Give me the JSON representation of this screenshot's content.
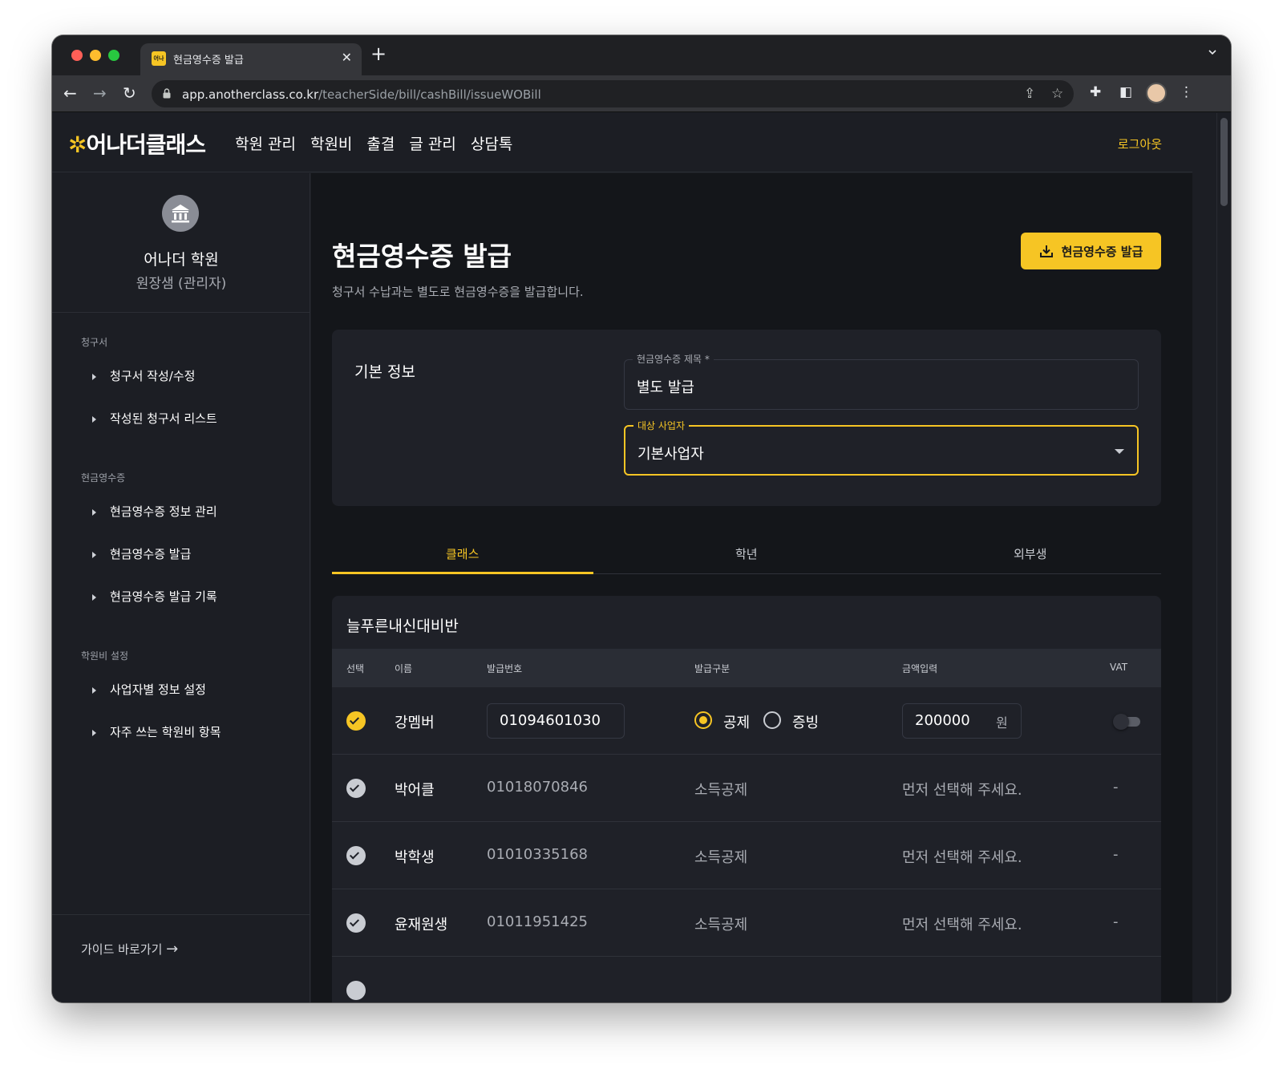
{
  "browser": {
    "tab_title": "현금영수증 발급",
    "favicon_text": "어나",
    "url_host": "app.anotherclass.co.kr",
    "url_path": "/teacherSide/bill/cashBill/issueWOBill"
  },
  "header": {
    "logo": "어나더클래스",
    "nav": [
      "학원 관리",
      "학원비",
      "출결",
      "글 관리",
      "상담톡"
    ],
    "logout": "로그아웃"
  },
  "sidebar": {
    "org_name": "어나더 학원",
    "org_role": "원장샘 (관리자)",
    "sections": [
      {
        "title": "청구서",
        "items": [
          "청구서 작성/수정",
          "작성된 청구서 리스트"
        ]
      },
      {
        "title": "현금영수증",
        "items": [
          "현금영수증 정보 관리",
          "현금영수증 발급",
          "현금영수증 발급 기록"
        ]
      },
      {
        "title": "학원비 설정",
        "items": [
          "사업자별 정보 설정",
          "자주 쓰는 학원비 항목"
        ]
      }
    ],
    "guide_link": "가이드 바로가기"
  },
  "main": {
    "title": "현금영수증 발급",
    "description": "청구서 수납과는 별도로 현금영수증을 발급합니다.",
    "issue_button": "현금영수증 발급",
    "basic_info": {
      "heading": "기본 정보",
      "receipt_title_label": "현금영수증 제목 *",
      "receipt_title_value": "별도 발급",
      "business_label": "대상 사업자",
      "business_value": "기본사업자"
    },
    "tabs": [
      "클래스",
      "학년",
      "외부생"
    ],
    "active_tab": "클래스",
    "class_name": "늘푸른내신대비반",
    "columns": [
      "선택",
      "이름",
      "발급번호",
      "발급구분",
      "금액입력",
      "VAT"
    ],
    "rows": [
      {
        "selected": true,
        "name": "강멤버",
        "number": "01094601030",
        "type_options": [
          "공제",
          "증빙"
        ],
        "type_selected": "공제",
        "amount": "200000",
        "unit": "원",
        "vat_on": false
      },
      {
        "selected": false,
        "name": "박어클",
        "number": "01018070846",
        "type": "소득공제",
        "amount_hint": "먼저 선택해 주세요.",
        "vat": "-"
      },
      {
        "selected": false,
        "name": "박학생",
        "number": "01010335168",
        "type": "소득공제",
        "amount_hint": "먼저 선택해 주세요.",
        "vat": "-"
      },
      {
        "selected": false,
        "name": "윤재원생",
        "number": "01011951425",
        "type": "소득공제",
        "amount_hint": "먼저 선택해 주세요.",
        "vat": "-"
      }
    ],
    "accent_color": "#f6c524"
  }
}
